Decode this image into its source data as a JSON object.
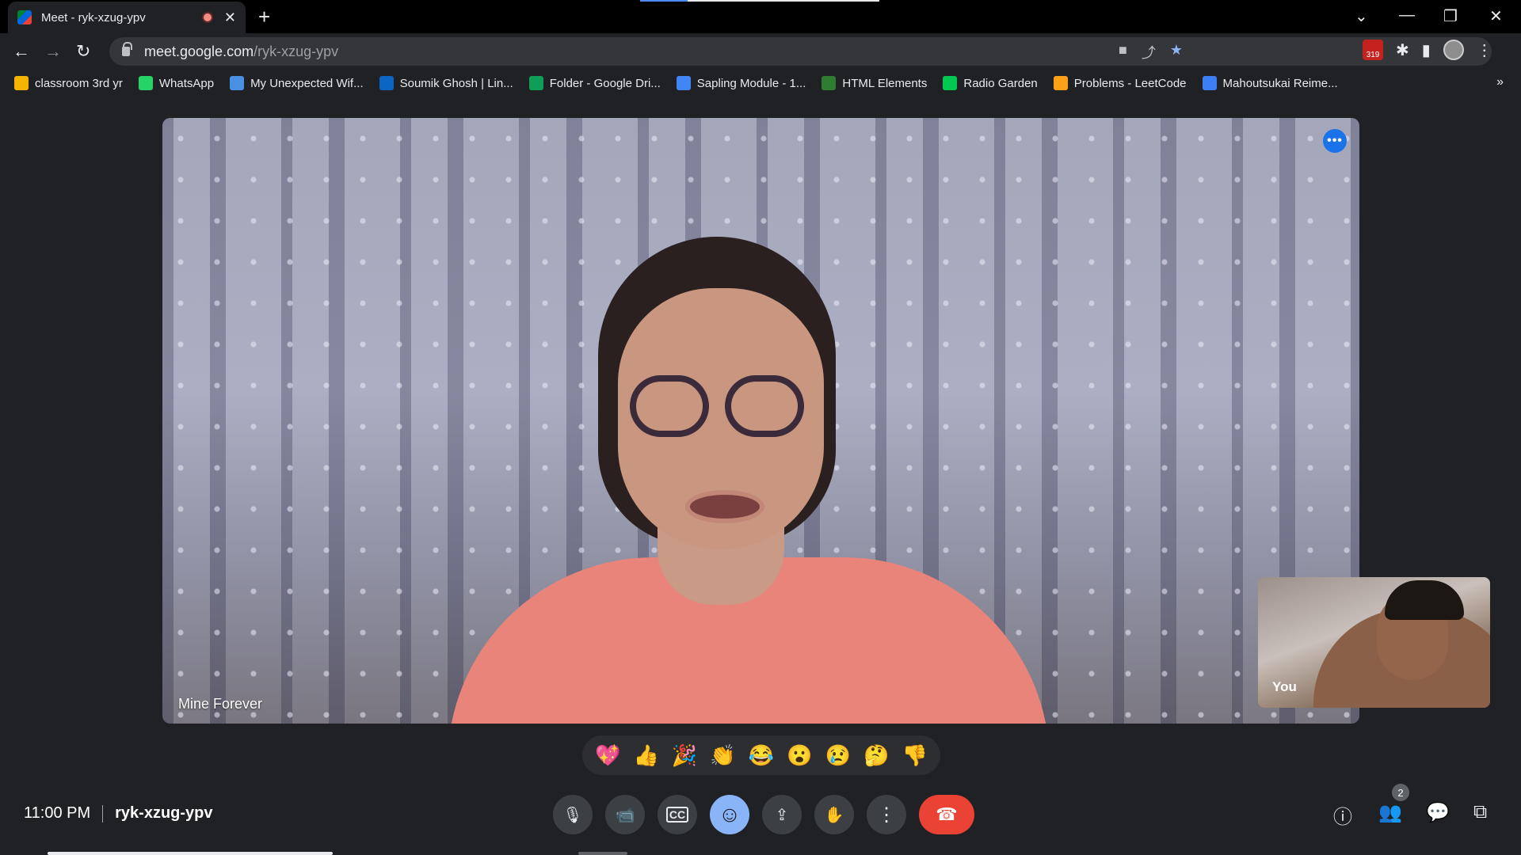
{
  "browser": {
    "tab_title": "Meet - ryk-xzug-ypv",
    "tab_close": "✕",
    "new_tab": "+",
    "url_host": "meet.google.com",
    "url_path": "/ryk-xzug-ypv",
    "extension_badge": "319",
    "window_controls": {
      "dropdown": "⌄",
      "minimize": "—",
      "restore": "❐",
      "close": "✕"
    },
    "bookmarks": [
      {
        "label": "classroom 3rd yr",
        "color": "#f4b400"
      },
      {
        "label": "WhatsApp",
        "color": "#25d366"
      },
      {
        "label": "My Unexpected Wif...",
        "color": "#4a90e2"
      },
      {
        "label": "Soumik Ghosh | Lin...",
        "color": "#0a66c2"
      },
      {
        "label": "Folder - Google Dri...",
        "color": "#0f9d58"
      },
      {
        "label": "Sapling Module - 1...",
        "color": "#4285f4"
      },
      {
        "label": "HTML Elements",
        "color": "#2e7d32"
      },
      {
        "label": "Radio Garden",
        "color": "#00c853"
      },
      {
        "label": "Problems - LeetCode",
        "color": "#ffa116"
      },
      {
        "label": "Mahoutsukai Reime...",
        "color": "#3d7ef5"
      }
    ],
    "bookmarks_more": "»"
  },
  "meet": {
    "main_participant": "Mine Forever",
    "self_label": "You",
    "time": "11:00 PM",
    "meeting_code": "ryk-xzug-ypv",
    "participant_count": "2",
    "reactions": [
      "💖",
      "👍",
      "🎉",
      "👏",
      "😂",
      "😮",
      "😢",
      "🤔",
      "👎"
    ],
    "icons": {
      "mic": "🎙",
      "camera": "📹",
      "captions": "CC",
      "emoji": "☺",
      "present": "⇪",
      "raise_hand": "✋",
      "more": "⋮",
      "end_call": "☎",
      "info": "ⓘ",
      "people": "👥",
      "chat": "💬",
      "activities": "⧉"
    }
  }
}
